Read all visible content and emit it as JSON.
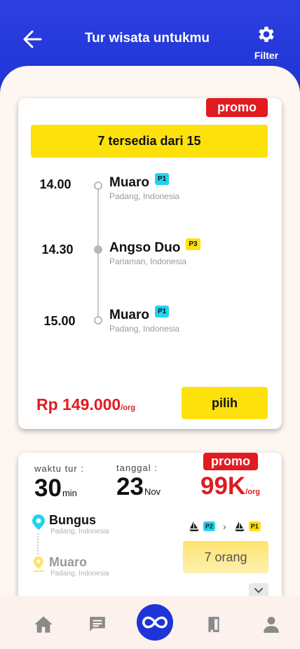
{
  "header": {
    "title": "Tur wisata untukmu",
    "filter_label": "Filter"
  },
  "tour1": {
    "promo": "promo",
    "availability": "7 tersedia dari 15",
    "stops": [
      {
        "time": "14.00",
        "name": "Muaro",
        "pier": "P1",
        "location": "Padang, Indonesia"
      },
      {
        "time": "14.30",
        "name": "Angso Duo",
        "pier": "P3",
        "location": "Pariaman, Indonesia"
      },
      {
        "time": "15.00",
        "name": "Muaro",
        "pier": "P1",
        "location": "Padang, Indonesia"
      }
    ],
    "price": "Rp 149.000",
    "price_unit": "/org",
    "select_label": "pilih"
  },
  "tour2": {
    "duration_label": "waktu tur :",
    "duration_value": "30",
    "duration_unit": "min",
    "date_label": "tanggal :",
    "date_day": "23",
    "date_month": "Nov",
    "promo": "promo",
    "price": "99K",
    "price_unit": "/org",
    "from": {
      "name": "Bungus",
      "location": "Padang, Indonesia"
    },
    "to": {
      "name": "Muaro",
      "location": "Padang, Indonesia"
    },
    "route": {
      "from_pier": "P2",
      "to_pier": "P1"
    },
    "people": "7 orang"
  },
  "colors": {
    "primary": "#1f34d6",
    "promo": "#e01b22",
    "accent": "#fde10c",
    "pier_cyan": "#22d3f0"
  },
  "nav": [
    "home-icon",
    "chat-icon",
    "infinity-icon",
    "ticket-icon",
    "profile-icon"
  ]
}
